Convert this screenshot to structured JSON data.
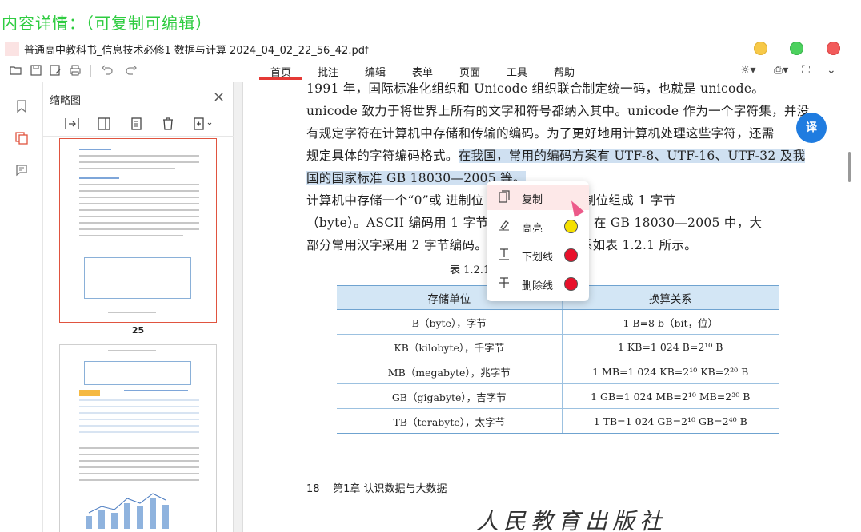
{
  "overlay_title": "内容详情：（可复制可编辑）",
  "window": {
    "file_title": "普通高中教科书_信息技术必修1 数据与计算 2024_04_02_22_56_42.pdf",
    "colors": {
      "minimize": "#f7c948",
      "maximize": "#4cd15e",
      "close": "#f25b5b"
    }
  },
  "toolbar": {
    "icons": [
      "open-folder-icon",
      "save-icon",
      "save-as-icon",
      "print-icon",
      "undo-icon",
      "redo-icon"
    ],
    "tabs": [
      {
        "label": "首页",
        "active": true
      },
      {
        "label": "批注",
        "active": false
      },
      {
        "label": "编辑",
        "active": false
      },
      {
        "label": "表单",
        "active": false
      },
      {
        "label": "页面",
        "active": false
      },
      {
        "label": "工具",
        "active": false
      },
      {
        "label": "帮助",
        "active": false
      }
    ],
    "right_icons": [
      "settings-icon",
      "share-icon",
      "fullscreen-icon",
      "chevron-down-icon"
    ]
  },
  "sidebar": {
    "icons": [
      "bookmark-icon",
      "thumbnail-icon",
      "comment-icon"
    ],
    "active": "thumbnail-icon"
  },
  "thumbnails": {
    "title": "缩略图",
    "tools": [
      "insert-page-icon",
      "split-page-icon",
      "extract-page-icon",
      "delete-page-icon",
      "add-page-icon"
    ],
    "pages": [
      {
        "number": "25",
        "selected": true
      },
      {
        "number": "",
        "selected": false
      }
    ]
  },
  "document": {
    "lines": [
      {
        "text": "1991 年，国际标准化组织和 Unicode 组织联合制定统一码，也就是 unicode。",
        "hl": ""
      },
      {
        "text": "unicode 致力于将世界上所有的文字和符号都纳入其中。unicode 作为一个字符集，并没",
        "hl": ""
      },
      {
        "text": "有规定字符在计算机中存储和传输的编码。为了更好地用计算机处理这些字符，还需",
        "hl": ""
      },
      {
        "text": "规定具体的字符编码格式。",
        "hl": "在我国，常用的编码方案有 UTF-8、UTF-16、UTF-32 及我"
      },
      {
        "text": "",
        "hl": "国的国家标准 GB 18030—2005 等。"
      },
      {
        "text": "    计算机中存储一个“0”或                     进制位（bit）。8 个二进制位组成 1 字节",
        "hl": ""
      },
      {
        "text": "（byte）。ASCII 编码用 1 字节表示                    和常见字符。在 GB 18030—2005 中，大",
        "hl": ""
      },
      {
        "text": "部分常用汉字采用 2 字节编码。                           储单位与换算关系如表 1.2.1 所示。",
        "hl": ""
      }
    ],
    "table_caption": "表 1.2.1                              储单位与换算关系",
    "table": {
      "headers": [
        "存储单位",
        "换算关系"
      ],
      "rows": [
        [
          "B（byte），字节",
          "1 B=8 b（bit，位）"
        ],
        [
          "KB（kilobyte），千字节",
          "1 KB=1 024 B=2¹⁰ B"
        ],
        [
          "MB（megabyte），兆字节",
          "1 MB=1 024 KB=2¹⁰ KB=2²⁰ B"
        ],
        [
          "GB（gigabyte），吉字节",
          "1 GB=1 024 MB=2¹⁰ MB=2³⁰ B"
        ],
        [
          "TB（terabyte），太字节",
          "1 TB=1 024 GB=2¹⁰  GB=2⁴⁰ B"
        ]
      ]
    },
    "footer": {
      "page_number": "18",
      "chapter": "第1章   认识数据与大数据"
    },
    "publisher": "人民教育出版社",
    "translate_label": "译"
  },
  "context_menu": {
    "items": [
      {
        "label": "复制",
        "icon": "copy-icon",
        "color": ""
      },
      {
        "label": "高亮",
        "icon": "highlight-icon",
        "color": "#f5e000"
      },
      {
        "label": "下划线",
        "icon": "underline-icon",
        "color": "#e8102a"
      },
      {
        "label": "删除线",
        "icon": "strikethrough-icon",
        "color": "#e8102a"
      }
    ]
  }
}
